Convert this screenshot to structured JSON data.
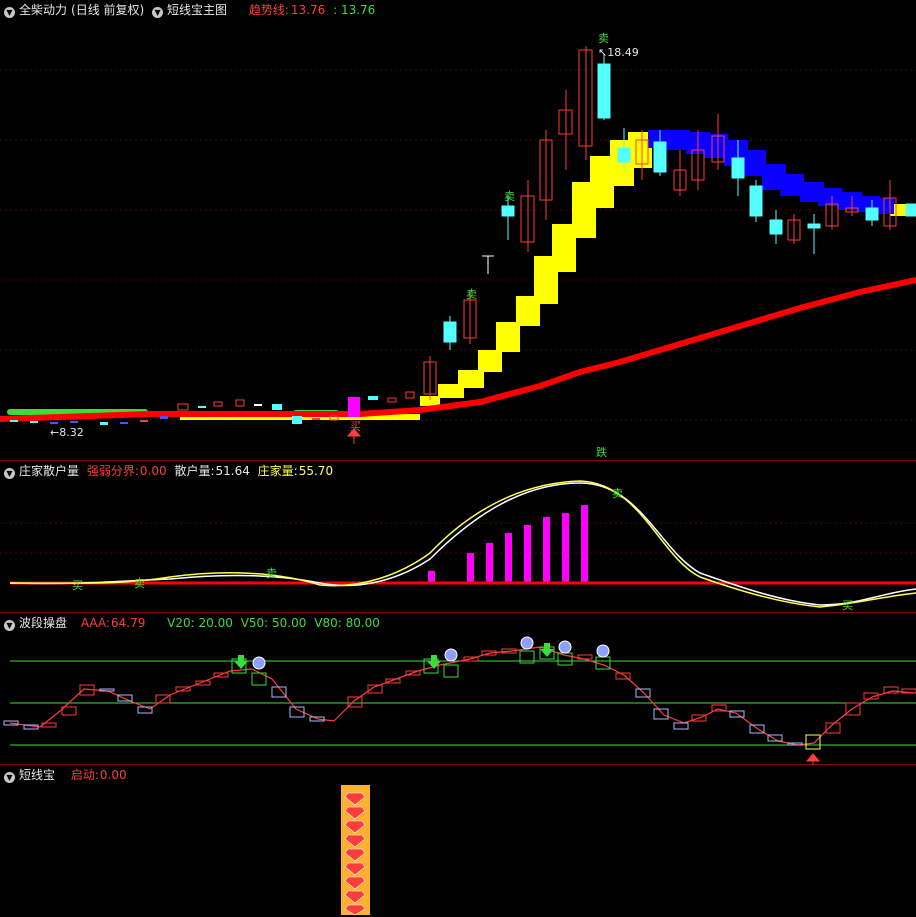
{
  "panels": {
    "main": {
      "stock_name": "全柴动力",
      "period": "(日线 前复权)",
      "indicator": "短线宝主图",
      "trend_label": "趋势线:",
      "trend_value": "13.76",
      "trend_value2": ": 13.76",
      "high_label": "18.49",
      "low_label": "8.32",
      "buy_mark": "买",
      "sell_mark": "卖",
      "fall_mark": "跌"
    },
    "zhuang": {
      "name": "庄家散户量",
      "label1": "强弱分界:",
      "value1": "0.00",
      "label2": "散户量:",
      "value2": "51.64",
      "label3": "庄家量:",
      "value3": "55.70",
      "sell_mark": "卖",
      "buy_mark": "买"
    },
    "boduan": {
      "name": "波段操盘",
      "aaa_label": "AAA:",
      "aaa_value": "64.79",
      "v20": "V20: 20.00",
      "v50": "V50: 50.00",
      "v80": "V80: 80.00"
    },
    "duanxian": {
      "name": "短线宝",
      "label": "启动:",
      "value": "0.00"
    }
  },
  "colors": {
    "up": "#ff3c3c",
    "down": "#54ffff",
    "ma": "#ff0000",
    "yellow_band": "#ffff00",
    "blue_band": "#0000ff",
    "magenta": "#ff00ff",
    "green": "#3cdc3c"
  }
}
